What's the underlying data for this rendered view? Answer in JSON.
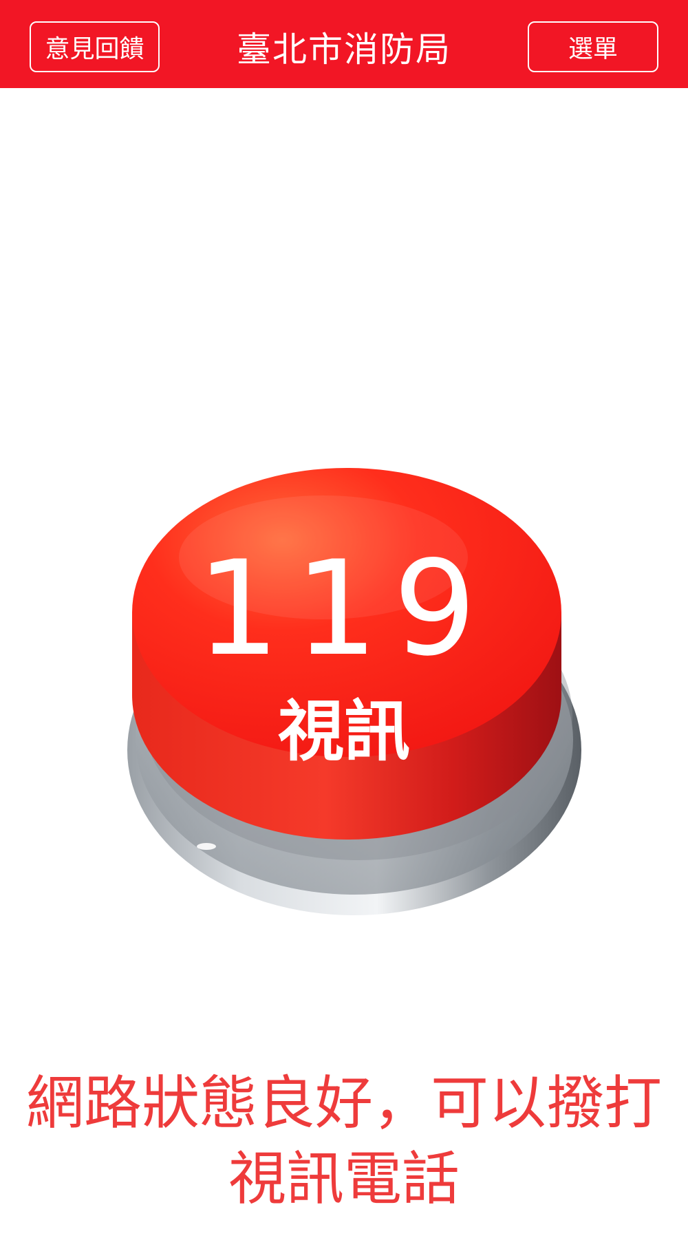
{
  "header": {
    "feedback_label": "意見回饋",
    "title": "臺北市消防局",
    "menu_label": "選單"
  },
  "call_button": {
    "number": "119",
    "label": "視訊"
  },
  "status_message": "網路狀態良好，可以撥打視訊電話",
  "colors": {
    "header_bg": "#f21625",
    "button_red": "#f02a1e",
    "status_text": "#ee3b3b"
  }
}
